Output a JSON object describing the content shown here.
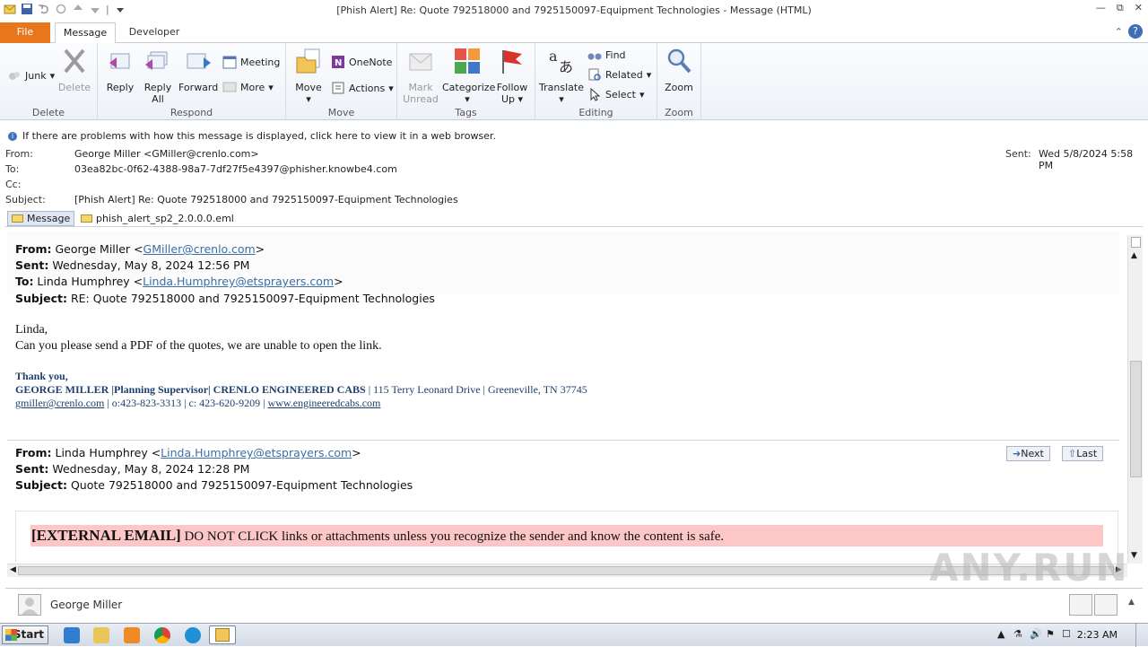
{
  "window": {
    "title": "[Phish Alert] Re: Quote 792518000 and 7925150097-Equipment Technologies  -  Message (HTML)"
  },
  "tabs": {
    "file": "File",
    "message": "Message",
    "developer": "Developer"
  },
  "ribbon": {
    "delete_group": {
      "label": "Delete",
      "junk": "Junk",
      "delete": "Delete"
    },
    "respond_group": {
      "label": "Respond",
      "reply": "Reply",
      "reply_all_1": "Reply",
      "reply_all_2": "All",
      "forward": "Forward",
      "meeting": "Meeting",
      "more": "More"
    },
    "move_group": {
      "label": "Move",
      "move": "Move",
      "onenote": "OneNote",
      "actions": "Actions"
    },
    "tags_group": {
      "label": "Tags",
      "mark_unread_1": "Mark",
      "mark_unread_2": "Unread",
      "categorize": "Categorize",
      "follow_up_1": "Follow",
      "follow_up_2": "Up"
    },
    "editing_group": {
      "label": "Editing",
      "translate": "Translate",
      "find": "Find",
      "related": "Related",
      "select": "Select"
    },
    "zoom_group": {
      "label": "Zoom",
      "zoom": "Zoom"
    }
  },
  "infobar": "If there are problems with how this message is displayed, click here to view it in a web browser.",
  "header": {
    "from_label": "From:",
    "from": "George Miller <GMiller@crenlo.com>",
    "to_label": "To:",
    "to": "03ea82bc-0f62-4388-98a7-7df27f5e4397@phisher.knowbe4.com",
    "cc_label": "Cc:",
    "subject_label": "Subject:",
    "subject": "[Phish Alert] Re: Quote 792518000 and 7925150097-Equipment Technologies",
    "sent_label": "Sent:",
    "sent": "Wed 5/8/2024 5:58 PM"
  },
  "attachments": {
    "message": "Message",
    "file": "phish_alert_sp2_2.0.0.0.eml"
  },
  "body": {
    "m1": {
      "from_label": "From:",
      "from_name": " George Miller <",
      "from_email": "GMiller@crenlo.com",
      "from_close": ">",
      "sent_label": "Sent:",
      "sent": " Wednesday, May 8, 2024 12:56 PM",
      "to_label": "To:",
      "to_name": " Linda Humphrey <",
      "to_email": "Linda.Humphrey@etsprayers.com",
      "to_close": ">",
      "subject_label": "Subject:",
      "subject": " RE: Quote 792518000 and 7925150097-Equipment Technologies",
      "greeting": "Linda,",
      "text": "Can you please send a PDF of the quotes, we are unable to open the link.",
      "sig_thanks": "Thank you,",
      "sig_line1_bold": "GEORGE MILLER |Planning Supervisor| CRENLO ENGINEERED CABS",
      "sig_line1_rest": " | 115 Terry Leonard Drive | Greeneville, TN 37745",
      "sig_email": "gmiller@crenlo.com",
      "sig_phones": " | o:423-823-3313 | c: 423-620-9209 | ",
      "sig_web": "www.engineeredcabs.com"
    },
    "m2": {
      "from_label": "From:",
      "from_name": " Linda Humphrey <",
      "from_email": "Linda.Humphrey@etsprayers.com",
      "from_close": ">",
      "sent_label": "Sent:",
      "sent": " Wednesday, May 8, 2024 12:28 PM",
      "subject_label": "Subject:",
      "subject": " Quote 792518000 and 7925150097-Equipment Technologies",
      "next": "Next",
      "last": "Last"
    },
    "external_bold": "[EXTERNAL EMAIL]",
    "external_text": " DO NOT CLICK links or attachments unless you recognize the sender and know the content is safe."
  },
  "people": {
    "name": "George Miller"
  },
  "taskbar": {
    "start": "Start",
    "clock": "2:23 AM"
  },
  "watermark": "ANY.RUN",
  "colors": {
    "file_tab": "#e8761c",
    "link": "#3b6fa5",
    "signature": "#1f3f6e",
    "external_banner": "#fdc7c7"
  }
}
